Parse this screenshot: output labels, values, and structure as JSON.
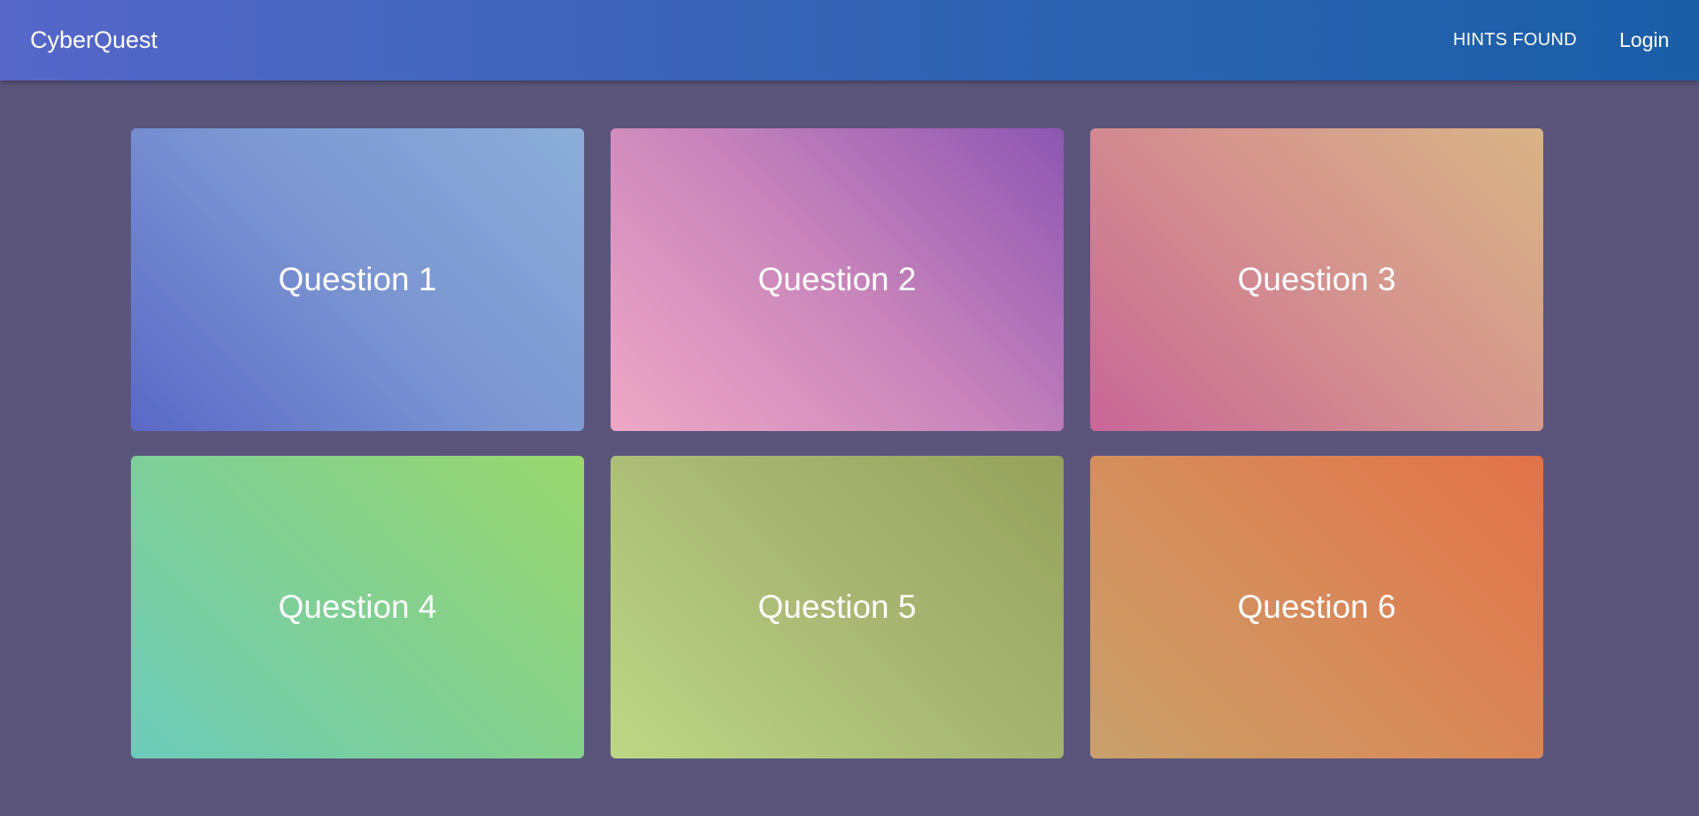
{
  "navbar": {
    "brand": "CyberQuest",
    "hints_label": "HINTS FOUND",
    "login_label": "Login"
  },
  "questions": [
    {
      "label": "Question 1",
      "colors": [
        "#5a69c7",
        "#8baed8"
      ]
    },
    {
      "label": "Question 2",
      "colors": [
        "#eea8c4",
        "#8c56b2"
      ]
    },
    {
      "label": "Question 3",
      "colors": [
        "#c86796",
        "#d8b486"
      ]
    },
    {
      "label": "Question 4",
      "colors": [
        "#6ccbb9",
        "#9ad76e"
      ]
    },
    {
      "label": "Question 5",
      "colors": [
        "#bcd786",
        "#96a25c"
      ]
    },
    {
      "label": "Question 6",
      "colors": [
        "#c8a06a",
        "#e27248"
      ]
    }
  ],
  "colors": {
    "background": "#5b557c",
    "navbar_start": "#5667c9",
    "navbar_end": "#1a5ea8",
    "text": "#ffffff"
  }
}
